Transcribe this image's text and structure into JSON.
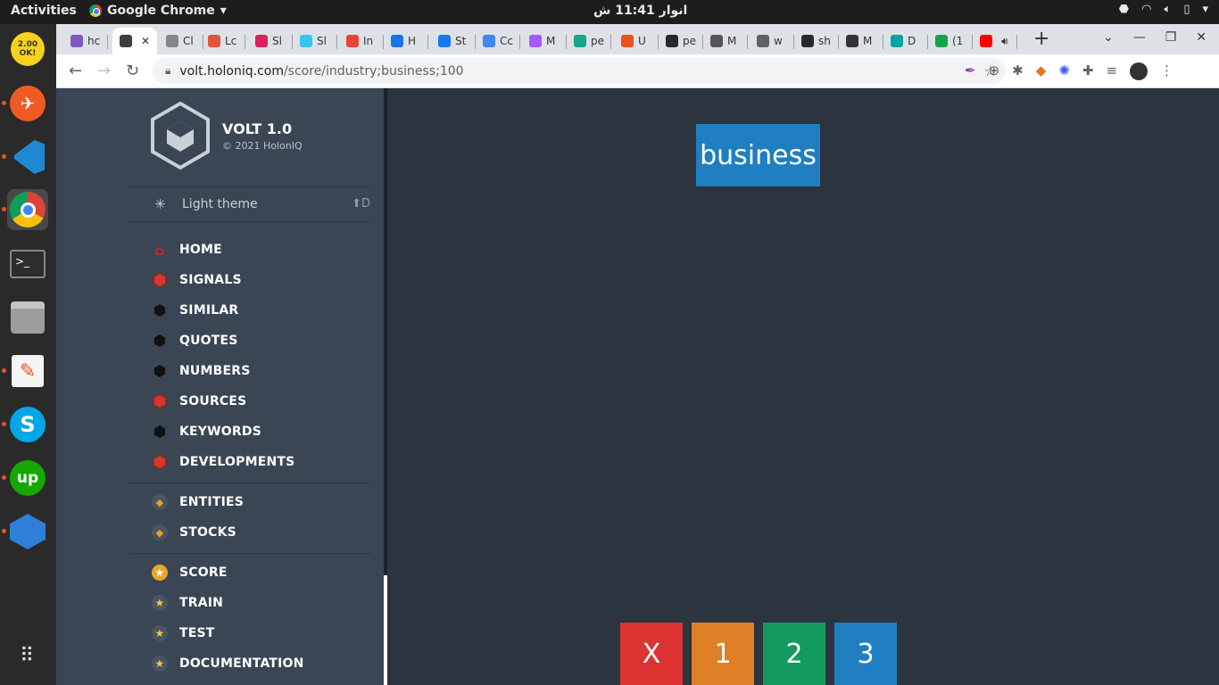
{
  "topbar": {
    "activities": "Activities",
    "app_name": "Google Chrome",
    "clock": "انوار 11:41 ش"
  },
  "dock": {
    "items": [
      "2.00 OK!",
      "postman",
      "vscode",
      "chrome",
      "terminal",
      "files",
      "text-editor",
      "skype",
      "upwork",
      "remmina"
    ]
  },
  "tabs": [
    {
      "label": "hc",
      "color": "#7e57c2"
    },
    {
      "label": "",
      "color": "#3c4043"
    },
    {
      "label": "Cl",
      "color": "#80868b"
    },
    {
      "label": "Lc",
      "color": "#e5533d"
    },
    {
      "label": "Sl",
      "color": "#e01e5a"
    },
    {
      "label": "Sl",
      "color": "#36c5f0"
    },
    {
      "label": "In",
      "color": "#ea4335"
    },
    {
      "label": "H",
      "color": "#1a73e8"
    },
    {
      "label": "St",
      "color": "#1877f2"
    },
    {
      "label": "Cc",
      "color": "#4285f4"
    },
    {
      "label": "M",
      "color": "#a259ff"
    },
    {
      "label": "pe",
      "color": "#17a589"
    },
    {
      "label": "U",
      "color": "#f24e1e"
    },
    {
      "label": "pe",
      "color": "#24292e"
    },
    {
      "label": "M",
      "color": "#555"
    },
    {
      "label": "w",
      "color": "#5f6368"
    },
    {
      "label": "sh",
      "color": "#24292e"
    },
    {
      "label": "M",
      "color": "#333"
    },
    {
      "label": "D",
      "color": "#00a3a6"
    },
    {
      "label": "(1",
      "color": "#16a34a"
    },
    {
      "label": "",
      "color": "#ff0000"
    }
  ],
  "browser": {
    "url_host": "volt.holoniq.com",
    "url_path": "/score/industry;business;100"
  },
  "sidebar": {
    "brand_title": "VOLT 1.0",
    "brand_sub": "© 2021 HolonIQ",
    "theme_label": "Light theme",
    "theme_key": "D",
    "menu": [
      {
        "label": "HOME",
        "icon": "home-icon"
      },
      {
        "label": "SIGNALS",
        "icon": "signals-icon"
      },
      {
        "label": "SIMILAR",
        "icon": "hexagon-icon"
      },
      {
        "label": "QUOTES",
        "icon": "hexagon-icon"
      },
      {
        "label": "NUMBERS",
        "icon": "hexagon-icon"
      },
      {
        "label": "SOURCES",
        "icon": "signals-icon"
      },
      {
        "label": "KEYWORDS",
        "icon": "hexagon-icon"
      },
      {
        "label": "DEVELOPMENTS",
        "icon": "signals-icon"
      },
      {
        "label": "ENTITIES",
        "icon": "diamond-icon"
      },
      {
        "label": "STOCKS",
        "icon": "diamond-icon"
      },
      {
        "label": "SCORE",
        "icon": "star-icon"
      },
      {
        "label": "TRAIN",
        "icon": "star-icon"
      },
      {
        "label": "TEST",
        "icon": "star-icon"
      },
      {
        "label": "DOCUMENTATION",
        "icon": "star-icon"
      }
    ]
  },
  "main": {
    "tag_label": "business",
    "buttons": [
      {
        "label": "X",
        "color": "#dd3333"
      },
      {
        "label": "1",
        "color": "#df7f26"
      },
      {
        "label": "2",
        "color": "#139a5e"
      },
      {
        "label": "3",
        "color": "#1f7fc2"
      }
    ]
  }
}
